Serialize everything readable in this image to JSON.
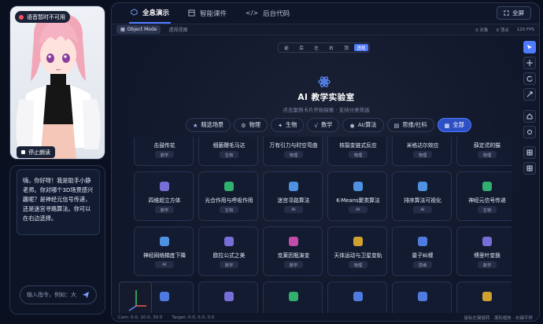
{
  "left": {
    "voice_status": "语音暂时不可用",
    "stop_button": "停止朗读",
    "chat_message": "嗨，你好呀！我是助手小静老师。你对哪个3D场景感兴趣呢？是神经元信号传递，还是迷宫寻路算法。你可以在右边选择。",
    "input_placeholder": "输入指令，例如：大"
  },
  "header": {
    "tabs": [
      {
        "label": "全息演示",
        "icon": "cube-icon"
      },
      {
        "label": "智能课件",
        "icon": "layout-icon"
      },
      {
        "label": "后台代码",
        "icon": "code-icon"
      }
    ],
    "fullscreen": "全屏"
  },
  "subbar": {
    "mode": "Object Mode",
    "view_tab": "透视视图",
    "objects": "0 对象",
    "vertices": "0 顶点",
    "fps": "120 FPS"
  },
  "views": [
    "前",
    "后",
    "左",
    "右",
    "顶",
    "透视"
  ],
  "lab": {
    "title": "AI 教学实验室",
    "subtitle": "点击案例卡片开始探索 · 支持分类筛选"
  },
  "filters": [
    {
      "label": "精选场景",
      "icon": "star-icon"
    },
    {
      "label": "物理",
      "icon": "atom-icon"
    },
    {
      "label": "生物",
      "icon": "leaf-icon"
    },
    {
      "label": "数学",
      "icon": "sqrt-icon"
    },
    {
      "label": "AI/算法",
      "icon": "robot-icon"
    },
    {
      "label": "思维/社科",
      "icon": "book-icon"
    },
    {
      "label": "全部",
      "icon": "grid-icon"
    }
  ],
  "cards": [
    {
      "name": "击鼓传花",
      "tag": "数学",
      "color": "#8b7cf6"
    },
    {
      "name": "细菌鞭毛马达",
      "tag": "生物",
      "color": "#37c97a"
    },
    {
      "name": "万有引力与时空弯曲",
      "tag": "物理",
      "color": "#5b8cff"
    },
    {
      "name": "核裂变链式反应",
      "tag": "物理",
      "color": "#5b8cff"
    },
    {
      "name": "米格达尔效应",
      "tag": "物理",
      "color": "#5b8cff"
    },
    {
      "name": "薛定谔的猫",
      "tag": "物理",
      "color": "#5b8cff"
    },
    {
      "name": "四维超立方体",
      "tag": "数学",
      "color": "#8b7cf6"
    },
    {
      "name": "光合作用与呼吸作用",
      "tag": "生物",
      "color": "#37c97a"
    },
    {
      "name": "迷宫寻路算法",
      "tag": "AI",
      "color": "#58a6ff"
    },
    {
      "name": "K-Means聚类算法",
      "tag": "AI",
      "color": "#58a6ff"
    },
    {
      "name": "排序算法可视化",
      "tag": "AI",
      "color": "#58a6ff"
    },
    {
      "name": "神经元信号传递",
      "tag": "生物",
      "color": "#37c97a"
    },
    {
      "name": "神经网络梯度下降",
      "tag": "AI",
      "color": "#58a6ff"
    },
    {
      "name": "欧拉公式之美",
      "tag": "数学",
      "color": "#8b7cf6"
    },
    {
      "name": "克莱因瓶演变",
      "tag": "数学",
      "color": "#e055c2"
    },
    {
      "name": "天体运动与卫星变轨",
      "tag": "物理",
      "color": "#f1b92f"
    },
    {
      "name": "量子纠缠",
      "tag": "思维",
      "color": "#5b8cff"
    },
    {
      "name": "傅里叶变换",
      "tag": "数学",
      "color": "#8b7cf6"
    },
    {
      "name": "",
      "tag": "",
      "color": "#5b8cff"
    },
    {
      "name": "",
      "tag": "",
      "color": "#8b7cf6"
    },
    {
      "name": "",
      "tag": "",
      "color": "#37c97a"
    },
    {
      "name": "",
      "tag": "",
      "color": "#5b8cff"
    },
    {
      "name": "",
      "tag": "",
      "color": "#5b8cff"
    },
    {
      "name": "",
      "tag": "",
      "color": "#f1b92f"
    }
  ],
  "status": {
    "cam": "Cam: 0.0, 10.0, 30.0",
    "target": "Target: 0.0, 0.0, 0.0",
    "hint": "鼠标左键旋转 · 滚轮缩放 · 右键平移"
  }
}
